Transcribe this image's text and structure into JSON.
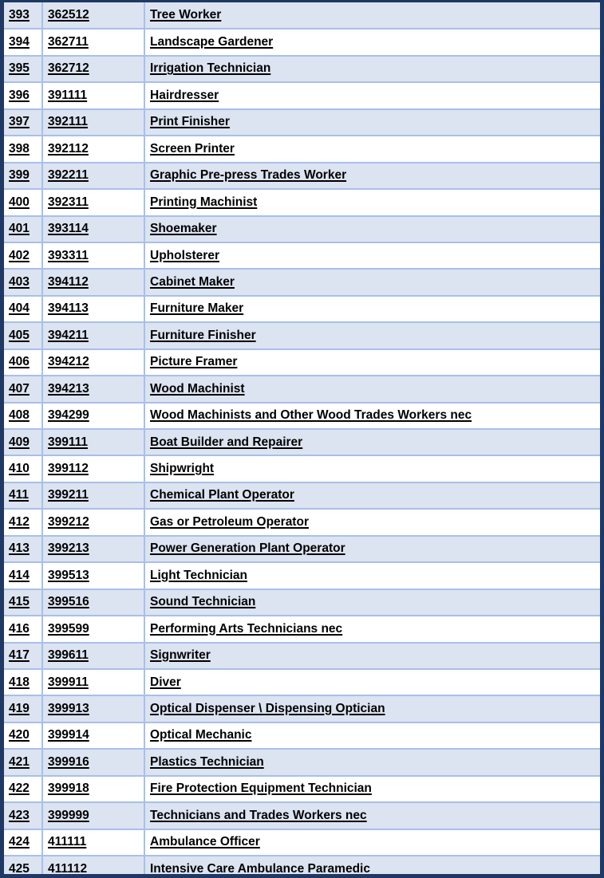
{
  "document": {
    "kind": "occupation-code-table",
    "columns": [
      "index",
      "code",
      "occupation_title"
    ],
    "colors": {
      "frame_border": "#1f3864",
      "grid_line": "#a8c0e8",
      "shaded_row": "#dce3f1",
      "plain_row": "#ffffff",
      "text": "#000000"
    },
    "row_count": 33,
    "first_index": "393",
    "last_index": "425"
  },
  "rows": [
    {
      "index": "393",
      "code": "362512",
      "title": "Tree Worker"
    },
    {
      "index": "394",
      "code": "362711",
      "title": "Landscape Gardener"
    },
    {
      "index": "395",
      "code": "362712",
      "title": "Irrigation Technician"
    },
    {
      "index": "396",
      "code": "391111",
      "title": "Hairdresser"
    },
    {
      "index": "397",
      "code": "392111",
      "title": "Print Finisher"
    },
    {
      "index": "398",
      "code": "392112",
      "title": "Screen Printer"
    },
    {
      "index": "399",
      "code": "392211",
      "title": "Graphic Pre-press Trades Worker"
    },
    {
      "index": "400",
      "code": "392311",
      "title": "Printing Machinist"
    },
    {
      "index": "401",
      "code": "393114",
      "title": "Shoemaker"
    },
    {
      "index": "402",
      "code": "393311",
      "title": "Upholsterer"
    },
    {
      "index": "403",
      "code": "394112",
      "title": "Cabinet Maker"
    },
    {
      "index": "404",
      "code": "394113",
      "title": "Furniture Maker"
    },
    {
      "index": "405",
      "code": "394211",
      "title": "Furniture Finisher"
    },
    {
      "index": "406",
      "code": "394212",
      "title": "Picture Framer"
    },
    {
      "index": "407",
      "code": "394213",
      "title": "Wood Machinist"
    },
    {
      "index": "408",
      "code": "394299",
      "title": "Wood Machinists and Other Wood Trades Workers nec"
    },
    {
      "index": "409",
      "code": "399111",
      "title": "Boat Builder and Repairer"
    },
    {
      "index": "410",
      "code": "399112",
      "title": "Shipwright"
    },
    {
      "index": "411",
      "code": "399211",
      "title": "Chemical Plant Operator"
    },
    {
      "index": "412",
      "code": "399212",
      "title": "Gas or Petroleum Operator"
    },
    {
      "index": "413",
      "code": "399213",
      "title": "Power Generation Plant Operator"
    },
    {
      "index": "414",
      "code": "399513",
      "title": "Light Technician"
    },
    {
      "index": "415",
      "code": "399516",
      "title": "Sound Technician"
    },
    {
      "index": "416",
      "code": "399599",
      "title": "Performing Arts Technicians nec"
    },
    {
      "index": "417",
      "code": "399611",
      "title": "Signwriter"
    },
    {
      "index": "418",
      "code": "399911",
      "title": "Diver"
    },
    {
      "index": "419",
      "code": "399913",
      "title": "Optical Dispenser \\ Dispensing Optician"
    },
    {
      "index": "420",
      "code": "399914",
      "title": "Optical Mechanic"
    },
    {
      "index": "421",
      "code": "399916",
      "title": "Plastics Technician"
    },
    {
      "index": "422",
      "code": "399918",
      "title": "Fire Protection Equipment Technician"
    },
    {
      "index": "423",
      "code": "399999",
      "title": "Technicians and Trades Workers nec"
    },
    {
      "index": "424",
      "code": "411111",
      "title": "Ambulance Officer"
    },
    {
      "index": "425",
      "code": "411112",
      "title": "Intensive Care Ambulance Paramedic"
    }
  ]
}
